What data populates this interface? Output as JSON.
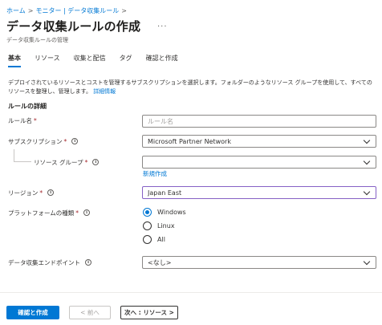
{
  "breadcrumb": [
    "ホーム",
    "モニター | データ収集ルール"
  ],
  "page": {
    "title": "データ収集ルールの作成",
    "more": "···",
    "subtitle": "データ収集ルールの管理"
  },
  "tabs": [
    "基本",
    "リソース",
    "収集と配信",
    "タグ",
    "確認と作成"
  ],
  "description": {
    "text": "デプロイされているリソースとコストを管理するサブスクリプションを選択します。フォルダーのようなリソース グループを使用して、すべてのリソースを整理し、管理します。",
    "link": "詳細情報"
  },
  "section_title": "ルールの詳細",
  "fields": {
    "rule_name": {
      "label": "ルール名",
      "placeholder": "ルール名"
    },
    "subscription": {
      "label": "サブスクリプション",
      "value": "Microsoft Partner Network"
    },
    "resource_group": {
      "label": "リソース グループ",
      "value": "",
      "create_new": "新規作成"
    },
    "region": {
      "label": "リージョン",
      "value": "Japan East"
    },
    "platform": {
      "label": "プラットフォームの種類",
      "options": [
        "Windows",
        "Linux",
        "All"
      ],
      "selected": "Windows"
    },
    "endpoint": {
      "label": "データ収集エンドポイント",
      "value": "<なし>"
    }
  },
  "required_mark": "*",
  "info_glyph": "i",
  "buttons": {
    "review_create": "確認と作成",
    "previous": "< 前へ",
    "next": "次へ : リソース >"
  },
  "colors": {
    "accent": "#0078d4",
    "required": "#a4262c",
    "focus_border": "#8661c5"
  }
}
